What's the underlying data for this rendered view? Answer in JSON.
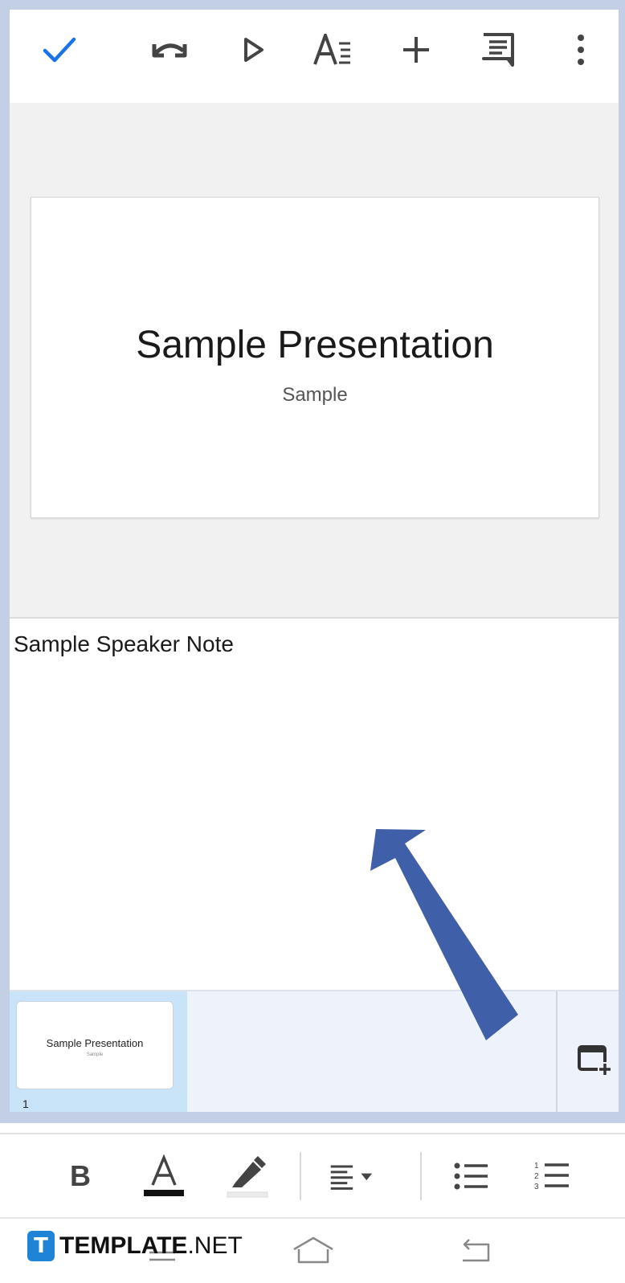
{
  "toolbar": {
    "icons": [
      "check-icon",
      "undo-icon",
      "play-icon",
      "text-format-icon",
      "add-icon",
      "comment-icon",
      "more-vertical-icon"
    ],
    "accent_color": "#1a73e8"
  },
  "slide": {
    "title": "Sample Presentation",
    "subtitle": "Sample"
  },
  "notes": {
    "text": "Sample Speaker Note"
  },
  "filmstrip": {
    "thumbnail": {
      "title": "Sample Presentation",
      "subtitle": "Sample",
      "number": "1"
    },
    "selected_color": "#c9e3f8"
  },
  "format_bar": {
    "bold_label": "B",
    "icons": [
      "bold-icon",
      "text-color-icon",
      "highlight-icon",
      "align-icon",
      "bulleted-list-icon",
      "numbered-list-icon"
    ]
  },
  "watermark": {
    "logo_letter": "T",
    "brand_bold": "TEMPLATE",
    "brand_suffix": ".NET"
  },
  "annotation": {
    "arrow_color": "#3f5fa8"
  }
}
